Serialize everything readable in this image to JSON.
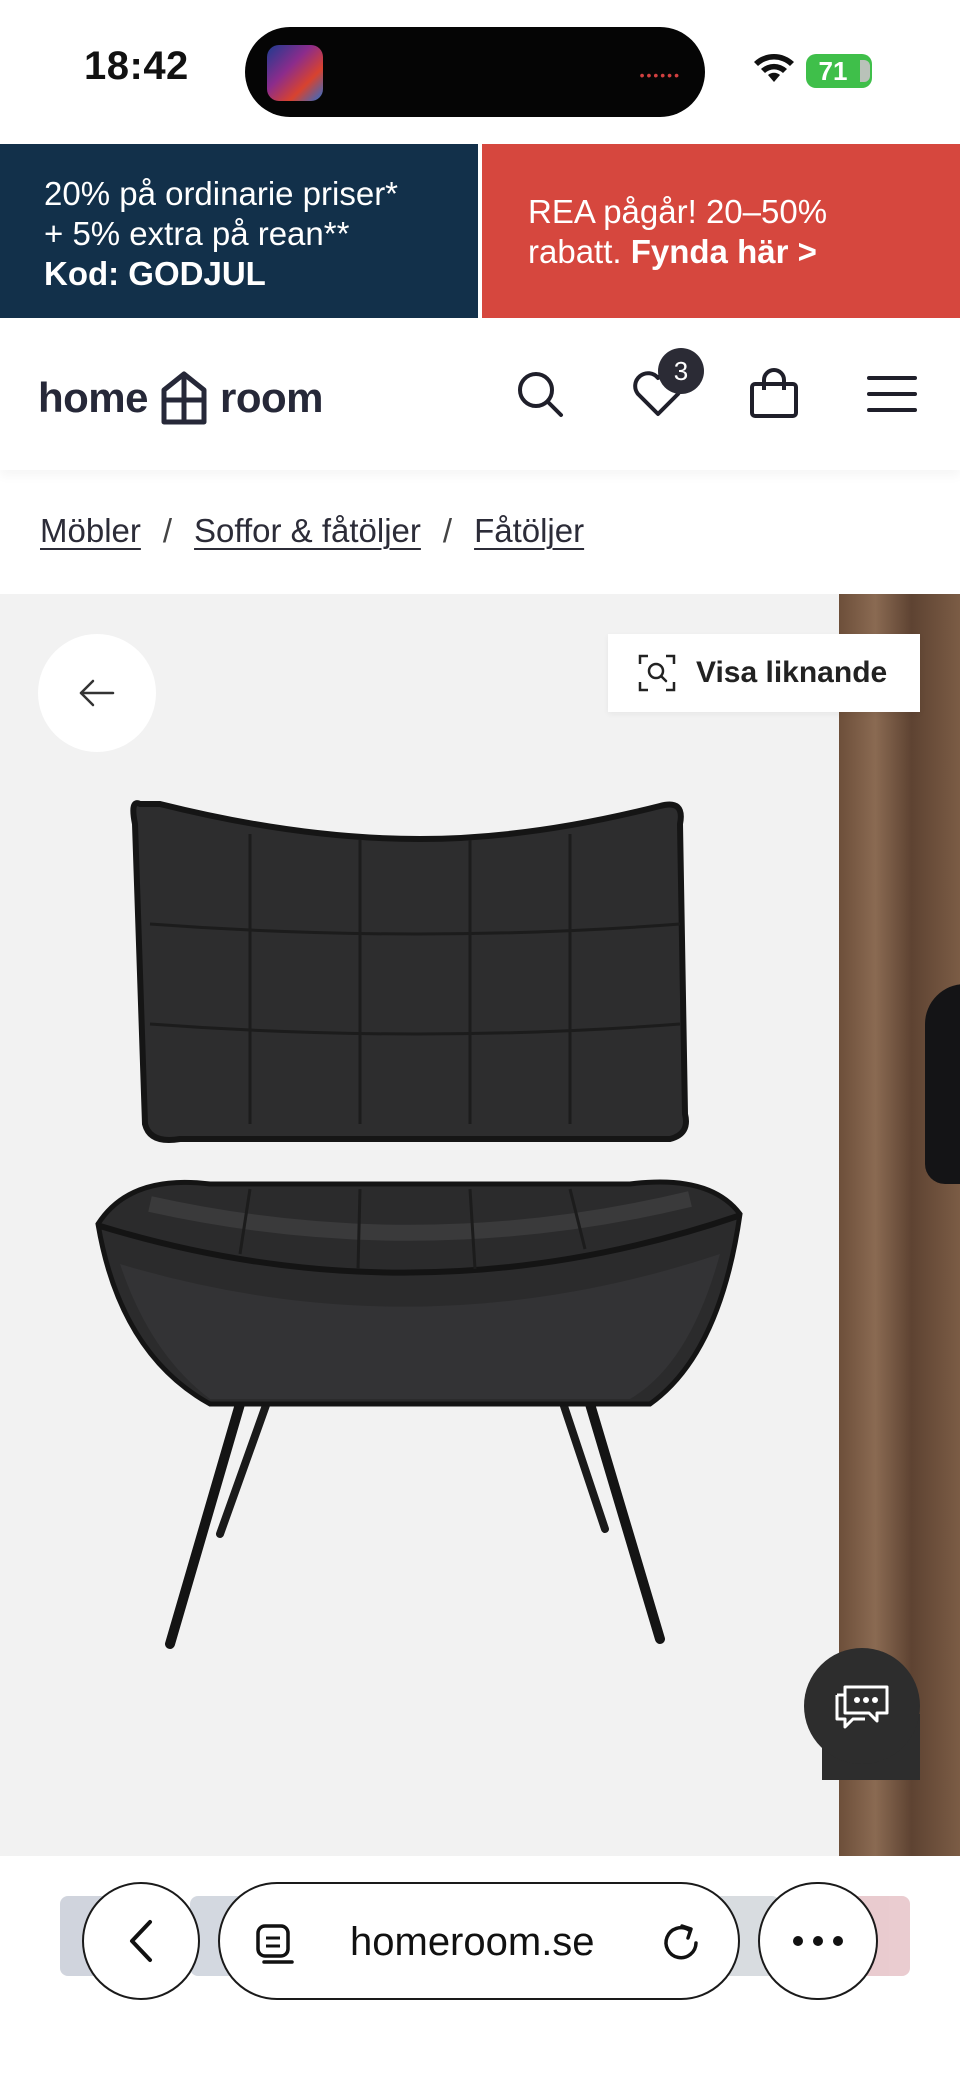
{
  "status_bar": {
    "time": "18:42",
    "battery": "71",
    "icons": [
      "wifi-icon",
      "battery-icon"
    ]
  },
  "promo": {
    "left_line1": "20% på ordinarie priser*",
    "left_line2": "+ 5% extra på rean**",
    "left_line3": "Kod: GODJUL",
    "right_line1": "REA pågår! 20–50%",
    "right_line2_prefix": "rabatt. ",
    "right_line2_link": "Fynda här >",
    "colors": {
      "left_bg": "#12304a",
      "right_bg": "#d6473e"
    }
  },
  "header": {
    "logo_left": "home",
    "logo_right": "room",
    "wishlist_count": "3",
    "icons": [
      "search-icon",
      "heart-icon",
      "bag-icon",
      "menu-icon"
    ]
  },
  "breadcrumb": {
    "items": [
      "Möbler",
      "Soffor & fåtöljer",
      "Fåtöljer"
    ],
    "separator": "/"
  },
  "gallery": {
    "similar_label": "Visa liknande",
    "icons": [
      "back-arrow-icon",
      "visual-search-icon",
      "chat-icon"
    ]
  },
  "browser": {
    "url": "homeroom.se",
    "icons": [
      "chevron-left-icon",
      "page-menu-icon",
      "reload-icon",
      "more-icon"
    ]
  }
}
